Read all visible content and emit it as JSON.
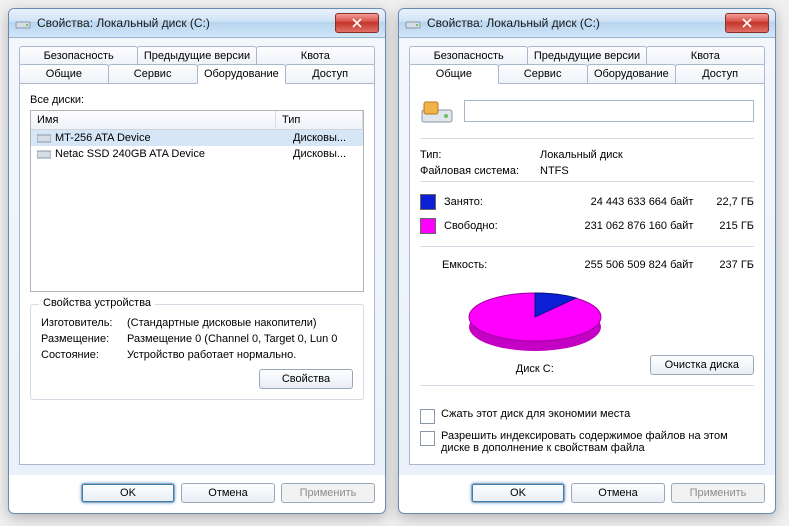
{
  "left": {
    "title": "Свойства: Локальный диск (C:)",
    "tabs_row1": [
      "Безопасность",
      "Предыдущие версии",
      "Квота"
    ],
    "tabs_row2": [
      "Общие",
      "Сервис",
      "Оборудование",
      "Доступ"
    ],
    "active_tab": "Оборудование",
    "all_drives_label": "Все диски:",
    "columns": {
      "name": "Имя",
      "type": "Тип"
    },
    "drives": [
      {
        "name": "MT-256 ATA Device",
        "type": "Дисковы...",
        "selected": true
      },
      {
        "name": "Netac SSD 240GB ATA Device",
        "type": "Дисковы...",
        "selected": false
      }
    ],
    "device_props_title": "Свойства устройства",
    "manufacturer_label": "Изготовитель:",
    "manufacturer_value": "(Стандартные дисковые накопители)",
    "location_label": "Размещение:",
    "location_value": "Размещение 0 (Channel 0, Target 0, Lun 0",
    "status_label": "Состояние:",
    "status_value": "Устройство работает нормально.",
    "props_button": "Свойства",
    "ok": "OK",
    "cancel": "Отмена",
    "apply": "Применить"
  },
  "right": {
    "title": "Свойства: Локальный диск (C:)",
    "tabs_row1": [
      "Безопасность",
      "Предыдущие версии",
      "Квота"
    ],
    "tabs_row2": [
      "Общие",
      "Сервис",
      "Оборудование",
      "Доступ"
    ],
    "active_tab": "Общие",
    "volume_name": "",
    "type_label": "Тип:",
    "type_value": "Локальный диск",
    "fs_label": "Файловая система:",
    "fs_value": "NTFS",
    "used_label": "Занято:",
    "used_bytes": "24 443 633 664 байт",
    "used_gb": "22,7 ГБ",
    "used_color": "#0a1fd6",
    "free_label": "Свободно:",
    "free_bytes": "231 062 876 160 байт",
    "free_gb": "215 ГБ",
    "free_color": "#ff00ff",
    "capacity_label": "Емкость:",
    "capacity_bytes": "255 506 509 824 байт",
    "capacity_gb": "237 ГБ",
    "pie_caption": "Диск C:",
    "cleanup": "Очистка диска",
    "compress": "Сжать этот диск для экономии места",
    "index": "Разрешить индексировать содержимое файлов на этом диске в дополнение к свойствам файла",
    "ok": "OK",
    "cancel": "Отмена",
    "apply": "Применить"
  }
}
